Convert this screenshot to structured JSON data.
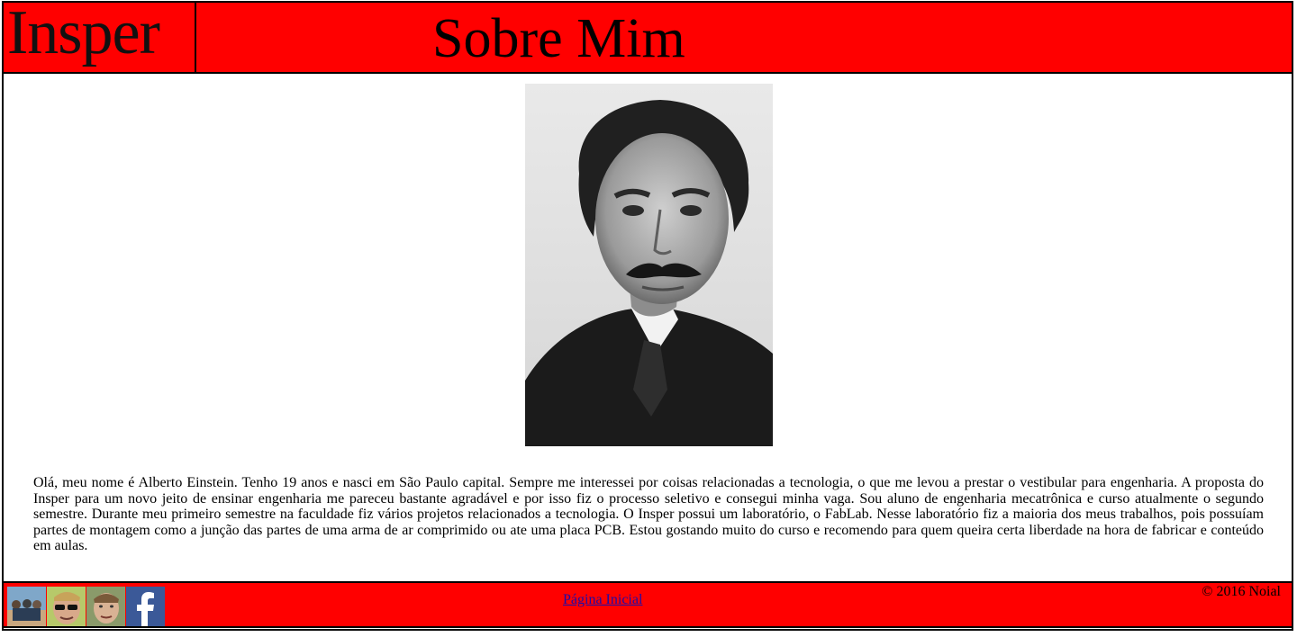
{
  "header": {
    "logo_text": "Insper",
    "title": "Sobre Mim"
  },
  "main": {
    "photo_alt": "Retrato de Alberto Einstein",
    "bio": "Olá, meu nome é Alberto Einstein. Tenho 19 anos e nasci em São Paulo capital. Sempre me interessei por coisas relacionadas a tecnologia, o que me levou a prestar o vestibular para engenharia. A proposta do Insper para um novo jeito de ensinar engenharia me pareceu bastante agradável e por isso fiz o processo seletivo e consegui minha vaga. Sou aluno de engenharia mecatrônica e curso atualmente o segundo semestre. Durante meu primeiro semestre na faculdade fiz vários projetos relacionados a tecnologia. O Insper possui um laboratório, o FabLab. Nesse laboratório fiz a maioria dos meus trabalhos, pois possuíam partes de montagem como a junção das partes de uma arma de ar comprimido ou ate uma placa PCB. Estou gostando muito do curso e recomendo para quem queira certa liberdade na hora de fabricar e conteúdo em aulas."
  },
  "footer": {
    "home_link": "Página Inicial",
    "copyright": "© 2016 Noial",
    "icons": [
      "photo-thumb-friends-icon",
      "photo-thumb-sunglasses-icon",
      "photo-thumb-selfie-icon",
      "facebook-icon"
    ]
  },
  "colors": {
    "brand_red": "#ff0000",
    "facebook_blue": "#3b5998",
    "link": "#1a0dab"
  }
}
